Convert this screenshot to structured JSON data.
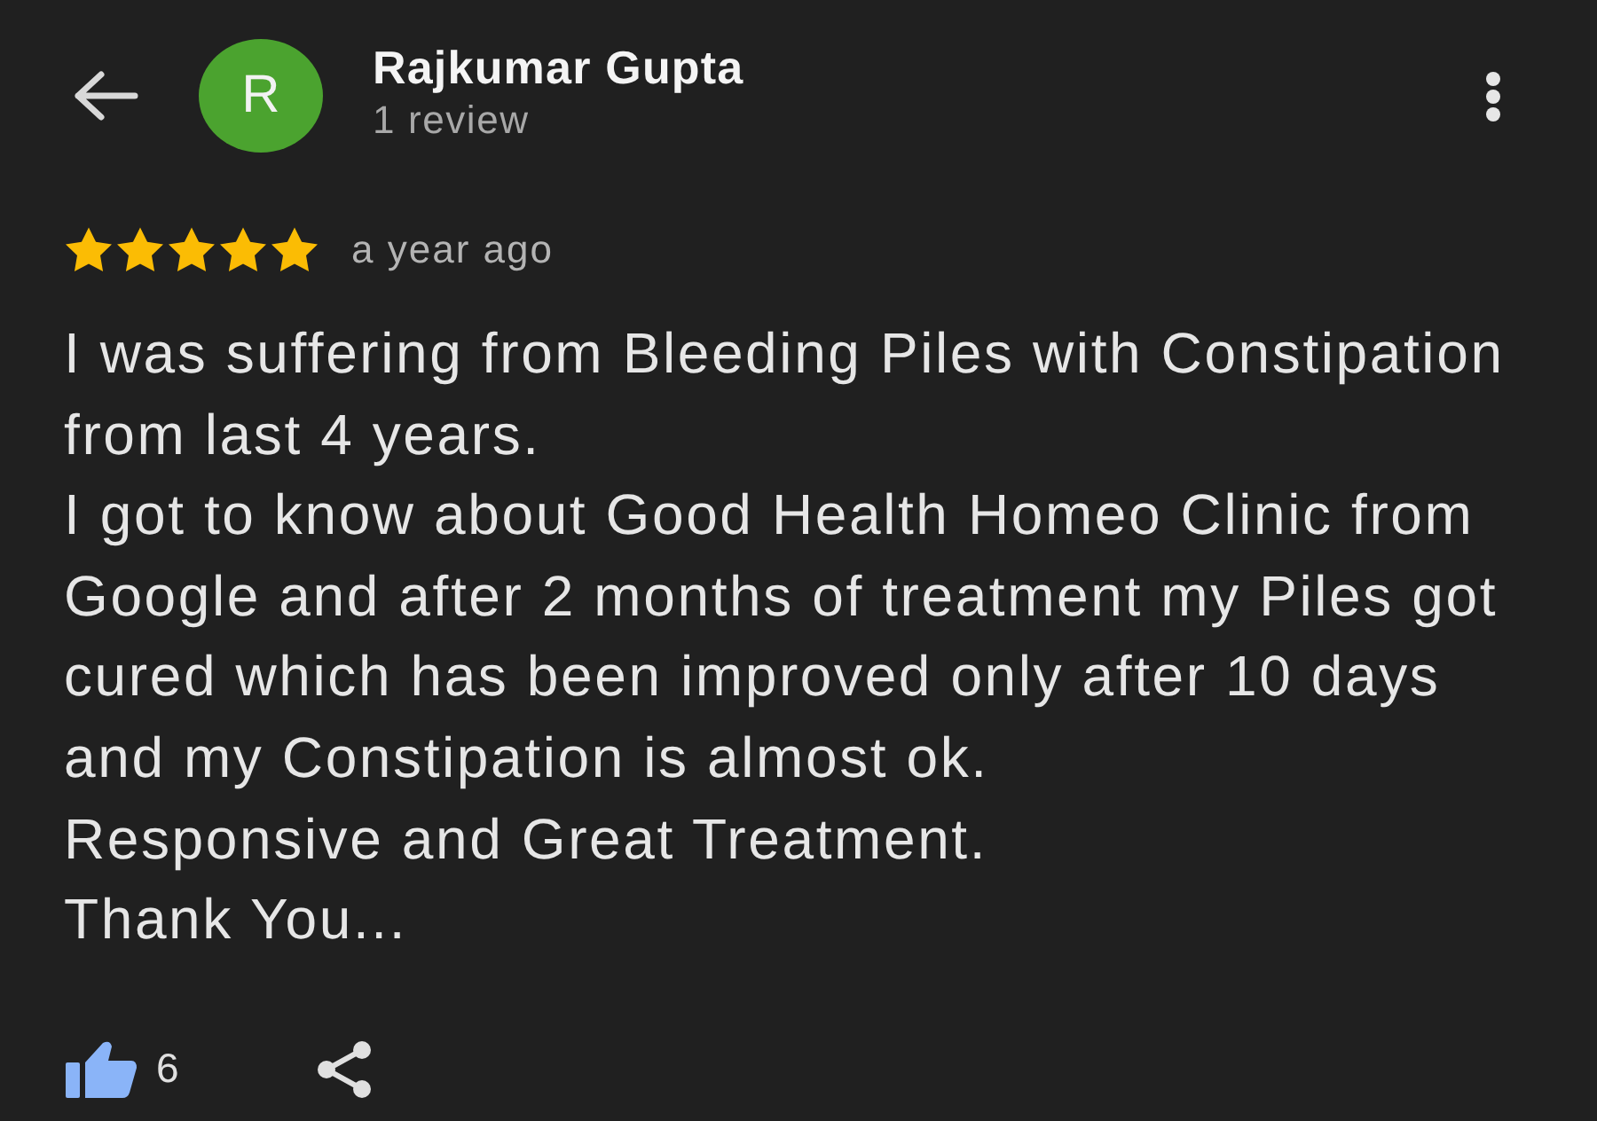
{
  "reviewer": {
    "initial": "R",
    "name": "Rajkumar Gupta",
    "review_count": "1 review"
  },
  "rating": {
    "stars": 5,
    "time": "a year ago"
  },
  "body": [
    "I was suffering from Bleeding Piles with Constipation from last 4 years.",
    "I got to know about Good Health Homeo Clinic from Google and after 2 months of treatment my Piles got cured which has been improved only after 10 days and my Constipation is almost ok.",
    "Responsive and Great Treatment.",
    "Thank You..."
  ],
  "actions": {
    "liked": true,
    "like_count": "6"
  }
}
